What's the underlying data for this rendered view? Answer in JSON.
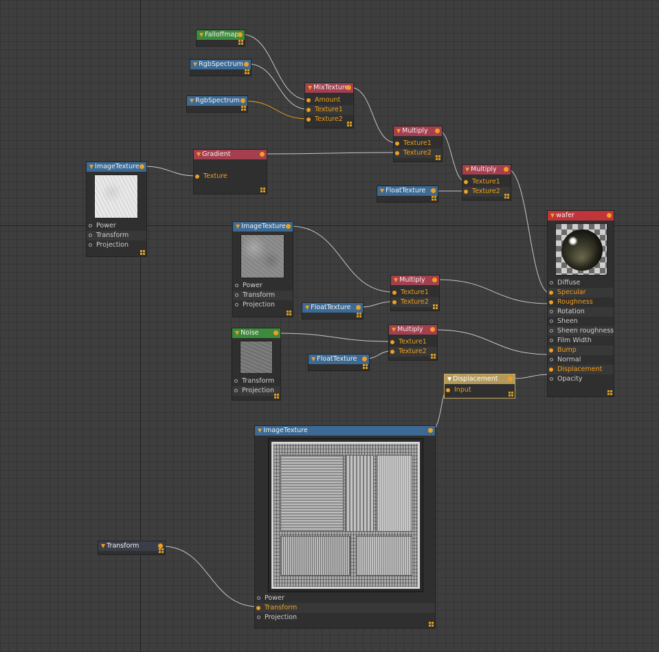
{
  "editor": {
    "colors": {
      "background": "#3e3e3e",
      "grid": "#353535",
      "wire": "#c8c8c8",
      "active_wire": "#f0a020",
      "port": "#f0a020"
    }
  },
  "nodes": {
    "falloffmap": {
      "title": "Falloffmap"
    },
    "rgb1": {
      "title": "RgbSpectrum"
    },
    "rgb2": {
      "title": "RgbSpectrum"
    },
    "mixtexture": {
      "title": "MixTexture",
      "inputs": [
        "Amount",
        "Texture1",
        "Texture2"
      ]
    },
    "gradient": {
      "title": "Gradient",
      "inputs": [
        "Texture"
      ]
    },
    "multiply1": {
      "title": "Multiply",
      "inputs": [
        "Texture1",
        "Texture2"
      ]
    },
    "multiply2": {
      "title": "Multiply",
      "inputs": [
        "Texture1",
        "Texture2"
      ]
    },
    "floattex1": {
      "title": "FloatTexture"
    },
    "imagetex1": {
      "title": "ImageTexture",
      "inputs": [
        "Power",
        "Transform",
        "Projection"
      ]
    },
    "imagetex2": {
      "title": "ImageTexture",
      "inputs": [
        "Power",
        "Transform",
        "Projection"
      ]
    },
    "multiply3": {
      "title": "Multiply",
      "inputs": [
        "Texture1",
        "Texture2"
      ]
    },
    "floattex2": {
      "title": "FloatTexture"
    },
    "noise": {
      "title": "Noise",
      "inputs": [
        "Transform",
        "Projection"
      ]
    },
    "multiply4": {
      "title": "Multiply",
      "inputs": [
        "Texture1",
        "Texture2"
      ]
    },
    "floattex3": {
      "title": "FloatTexture"
    },
    "displacement": {
      "title": "Displacement",
      "inputs": [
        "Input"
      ]
    },
    "wafer": {
      "title": "wafer",
      "inputs": [
        "Diffuse",
        "Specular",
        "Roughness",
        "Rotation",
        "Sheen",
        "Sheen roughness",
        "Film Width",
        "Bump",
        "Normal",
        "Displacement",
        "Opacity"
      ]
    },
    "imagetex3": {
      "title": "ImageTexture",
      "inputs": [
        "Power",
        "Transform",
        "Projection"
      ]
    },
    "transform": {
      "title": "Transform"
    }
  }
}
